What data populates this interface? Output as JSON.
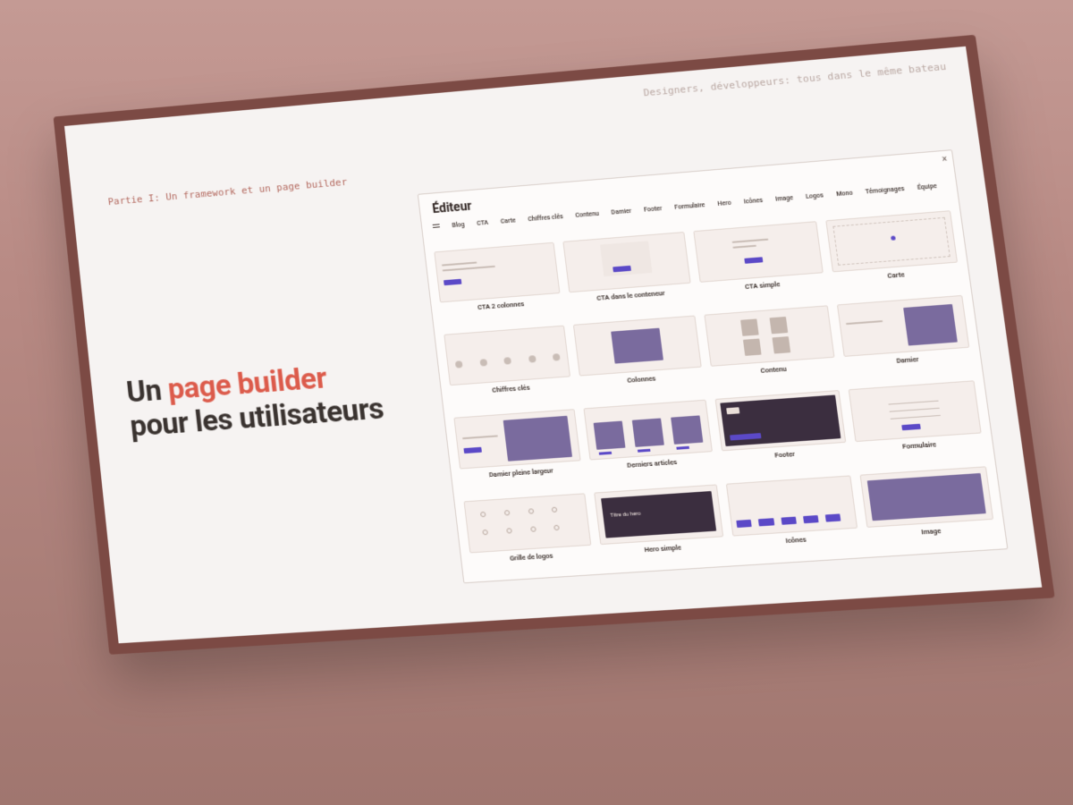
{
  "slide": {
    "subtitle_right": "Designers, développeurs: tous dans le même bateau",
    "subtitle_left": "Partie I: Un framework et un page builder",
    "headline_prefix": "Un ",
    "headline_accent": "page builder",
    "headline_suffix": "pour les utilisateurs"
  },
  "editor": {
    "title": "Éditeur",
    "close": "×",
    "tabs": [
      "Blog",
      "CTA",
      "Carte",
      "Chiffres clés",
      "Contenu",
      "Damier",
      "Footer",
      "Formulaire",
      "Hero",
      "Icônes",
      "Image",
      "Logos",
      "Mono",
      "Témoignages",
      "Équipe"
    ],
    "blocks": [
      {
        "label": "CTA 2 colonnes",
        "key": "cta2col"
      },
      {
        "label": "CTA dans le conteneur",
        "key": "ctacont"
      },
      {
        "label": "CTA simple",
        "key": "ctasimple"
      },
      {
        "label": "Carte",
        "key": "carte"
      },
      {
        "label": "Chiffres clés",
        "key": "chiffres"
      },
      {
        "label": "Colonnes",
        "key": "colonnes"
      },
      {
        "label": "Contenu",
        "key": "contenu"
      },
      {
        "label": "Damier",
        "key": "damier"
      },
      {
        "label": "Damier pleine largeur",
        "key": "damierpl"
      },
      {
        "label": "Derniers articles",
        "key": "articles"
      },
      {
        "label": "Footer",
        "key": "footer"
      },
      {
        "label": "Formulaire",
        "key": "form"
      },
      {
        "label": "Grille de logos",
        "key": "logos"
      },
      {
        "label": "Hero simple",
        "key": "hero"
      },
      {
        "label": "Icônes",
        "key": "icones"
      },
      {
        "label": "Image",
        "key": "image"
      }
    ]
  },
  "hero_placeholder": "Titre du hero"
}
